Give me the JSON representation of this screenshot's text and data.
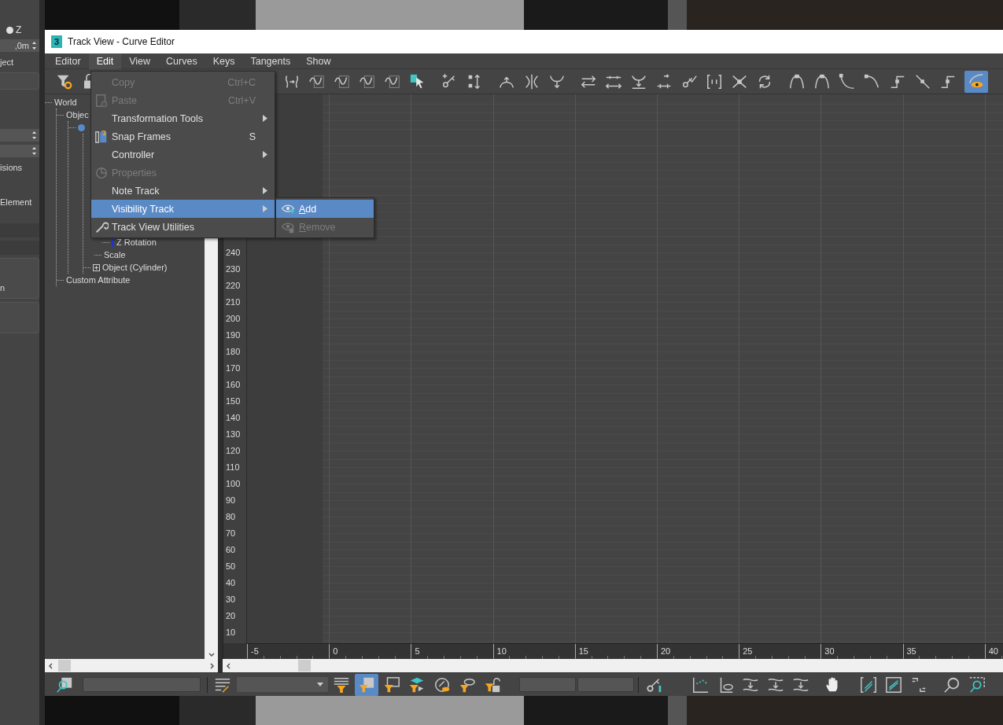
{
  "left_panel": {
    "radio": {
      "label": "Z",
      "selected": true
    },
    "spinner_value": ",0m",
    "labels": [
      "ject",
      "isions",
      "Element",
      "n"
    ]
  },
  "window": {
    "logo_text": "3",
    "title": "Track View - Curve Editor"
  },
  "menu_bar": [
    {
      "label": "Editor",
      "selected": false
    },
    {
      "label": "Edit",
      "selected": true
    },
    {
      "label": "View",
      "selected": false
    },
    {
      "label": "Curves",
      "selected": false
    },
    {
      "label": "Keys",
      "selected": false
    },
    {
      "label": "Tangents",
      "selected": false
    },
    {
      "label": "Show",
      "selected": false
    }
  ],
  "toolbar": {
    "buttons": [
      {
        "selected": false
      },
      {
        "selected": false
      },
      {
        "selected": false
      },
      {
        "selected": false
      },
      {
        "selected": false
      },
      {
        "selected": false
      },
      {
        "selected": false
      },
      {
        "selected": false
      },
      {
        "selected": false
      },
      {
        "selected": false
      },
      {
        "selected": false
      },
      {
        "selected": false
      },
      {
        "selected": false
      },
      {
        "selected": false
      },
      {
        "selected": false
      },
      {
        "selected": false
      },
      {
        "selected": false
      },
      {
        "selected": false
      },
      {
        "selected": false
      },
      {
        "selected": false
      },
      {
        "selected": false
      },
      {
        "selected": false
      },
      {
        "selected": false
      },
      {
        "selected": false
      },
      {
        "selected": false
      },
      {
        "selected": false
      },
      {
        "selected": false
      },
      {
        "selected": false
      },
      {
        "selected": true
      }
    ]
  },
  "edit_menu": {
    "items": [
      {
        "label": "Copy",
        "shortcut": "Ctrl+C",
        "disabled": true,
        "submenu": false,
        "selected": false
      },
      {
        "label": "Paste",
        "shortcut": "Ctrl+V",
        "disabled": true,
        "submenu": false,
        "selected": false
      },
      {
        "label": "Transformation Tools",
        "disabled": false,
        "submenu": true,
        "selected": false
      },
      {
        "label": "Snap Frames",
        "shortcut": "S",
        "disabled": false,
        "submenu": false,
        "selected": false
      },
      {
        "label": "Controller",
        "disabled": false,
        "submenu": true,
        "selected": false
      },
      {
        "label": "Properties",
        "disabled": true,
        "submenu": false,
        "selected": false
      },
      {
        "label": "Note Track",
        "disabled": false,
        "submenu": true,
        "selected": false
      },
      {
        "label": "Visibility Track",
        "disabled": false,
        "submenu": true,
        "selected": true
      },
      {
        "label": "Track View Utilities",
        "disabled": false,
        "submenu": false,
        "selected": false
      }
    ]
  },
  "visibility_submenu": {
    "items": [
      {
        "label": "Add",
        "selected": true,
        "disabled": false
      },
      {
        "label": "Remove",
        "selected": false,
        "disabled": true
      }
    ]
  },
  "tree": [
    {
      "label": "World",
      "children": [
        {
          "label": "Objec",
          "children": [
            {
              "kind": "object",
              "children": [
                {
                  "label": "Z Rotation",
                  "kind": "rotation"
                },
                {
                  "label": "Scale",
                  "kind": "transform-track"
                },
                {
                  "label": "Object (Cylinder)",
                  "kind": "object-track",
                  "expanded": false
                }
              ]
            }
          ]
        },
        {
          "label": "Custom Attribute"
        }
      ]
    }
  ],
  "curve_editor": {
    "y_labels": [
      "240",
      "230",
      "220",
      "210",
      "200",
      "190",
      "180",
      "170",
      "160",
      "150",
      "140",
      "130",
      "120",
      "110",
      "100",
      "90",
      "80",
      "70",
      "60",
      "50",
      "40",
      "30",
      "20",
      "10"
    ],
    "x_labels": [
      "-5",
      "0",
      "5",
      "10",
      "15",
      "20",
      "25",
      "30",
      "35",
      "40"
    ]
  },
  "bottom_toolbar": {
    "buttons": [
      {
        "selected": false
      },
      {
        "selected": false
      },
      {
        "selected": false
      },
      {
        "selected": true
      },
      {
        "selected": false
      },
      {
        "selected": false
      },
      {
        "selected": false
      },
      {
        "selected": false
      },
      {
        "selected": false
      },
      {
        "selected": false
      },
      {
        "selected": false
      },
      {
        "selected": false
      },
      {
        "selected": false
      },
      {
        "selected": false
      },
      {
        "selected": false
      },
      {
        "selected": false
      },
      {
        "selected": false
      },
      {
        "selected": false
      },
      {
        "selected": false
      },
      {
        "selected": false
      },
      {
        "selected": false
      }
    ]
  }
}
